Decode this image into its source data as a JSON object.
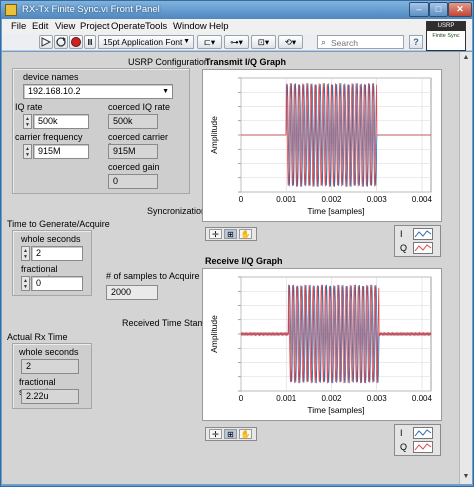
{
  "window": {
    "title": "RX-Tx Finite Sync.vi Front Panel",
    "minimize": "–",
    "maximize": "□",
    "close": "✕"
  },
  "menu": [
    "File",
    "Edit",
    "View",
    "Project",
    "Operate",
    "Tools",
    "Window",
    "Help"
  ],
  "toolbar": {
    "run_icon": "run-arrow-icon",
    "run_cont_icon": "run-continuously-icon",
    "abort_icon": "abort-icon",
    "pause_label": "II",
    "font": "15pt Application Font",
    "search_placeholder": "Search",
    "help_label": "?"
  },
  "vi_icon": {
    "title": "USRP",
    "subtitle": "Finite Sync"
  },
  "usrp": {
    "section": "USRP Configuration",
    "device_names_label": "device names",
    "device_names_value": "192.168.10.2",
    "iq_rate_label": "IQ rate",
    "iq_rate_value": "500k",
    "coerced_iq_rate_label": "coerced IQ rate",
    "coerced_iq_rate_value": "500k",
    "carrier_label": "carrier frequency",
    "carrier_value": "915M",
    "coerced_carrier_label": "coerced carrier frequency",
    "coerced_carrier_value": "915M",
    "coerced_gain_label": "coerced gain",
    "coerced_gain_value": "0"
  },
  "sync": {
    "section": "Syncronization",
    "time_cluster_label": "Time to Generate/Acquire",
    "whole_label": "whole seconds",
    "whole_value": "2",
    "frac_label": "fractional seconds",
    "frac_value": "0",
    "samples_label": "# of samples to Acquire",
    "samples_value": "2000"
  },
  "rx_stamp": {
    "section": "Received Time Stamp",
    "cluster_label": "Actual Rx Time",
    "whole_label": "whole seconds",
    "whole_value": "2",
    "frac_label": "fractional seconds",
    "frac_value": "2.22u"
  },
  "tx_graph": {
    "title": "Transmit I/Q Graph",
    "xlabel": "Time [samples]",
    "ylabel": "Amplitude",
    "xticks": [
      "0",
      "0.001",
      "0.002",
      "0.003",
      "0.004"
    ],
    "legend": [
      "I",
      "Q"
    ]
  },
  "rx_graph": {
    "title": "Receive I/Q Graph",
    "xlabel": "Time [samples]",
    "ylabel": "Amplitude",
    "xticks": [
      "0",
      "0.001",
      "0.002",
      "0.003",
      "0.004"
    ],
    "legend": [
      "I",
      "Q"
    ]
  },
  "palette": {
    "icons": [
      "cursor-icon",
      "zoom-icon",
      "hand-icon"
    ]
  },
  "colors": {
    "i_trace": "#2a6fb5",
    "q_trace": "#e04848",
    "panel": "#d4d4d4",
    "titlebar": "#6aa0cf"
  }
}
